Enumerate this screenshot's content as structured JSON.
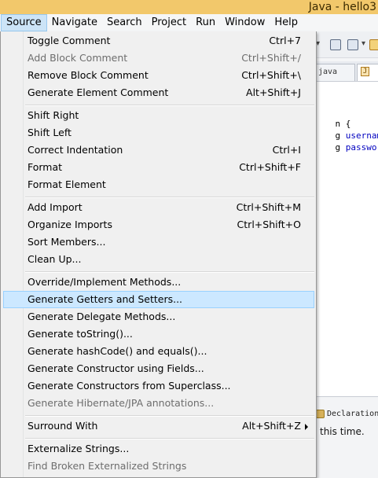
{
  "window": {
    "title": "Java - hello3"
  },
  "menubar": {
    "items": [
      {
        "label": "Source"
      },
      {
        "label": "Navigate"
      },
      {
        "label": "Search"
      },
      {
        "label": "Project"
      },
      {
        "label": "Run"
      },
      {
        "label": "Window"
      },
      {
        "label": "Help"
      }
    ]
  },
  "tabs": {
    "inactive_label": "java",
    "active_label": "*"
  },
  "editor": {
    "lines": [
      {
        "pre": "n {",
        "var": "",
        "post": ""
      },
      {
        "pre": "g ",
        "var": "username",
        "post": ";"
      },
      {
        "pre": "g ",
        "var": "password",
        "post": ";"
      }
    ]
  },
  "lower_panel": {
    "tab_label": "Declaration",
    "message": "this time."
  },
  "menu": {
    "items": [
      {
        "label": "Toggle Comment",
        "shortcut": "Ctrl+7",
        "disabled": false
      },
      {
        "label": "Add Block Comment",
        "shortcut": "Ctrl+Shift+/",
        "disabled": true
      },
      {
        "label": "Remove Block Comment",
        "shortcut": "Ctrl+Shift+\\",
        "disabled": false
      },
      {
        "label": "Generate Element Comment",
        "shortcut": "Alt+Shift+J",
        "disabled": false
      },
      {
        "label": "Shift Right",
        "shortcut": "",
        "disabled": false
      },
      {
        "label": "Shift Left",
        "shortcut": "",
        "disabled": false
      },
      {
        "label": "Correct Indentation",
        "shortcut": "Ctrl+I",
        "disabled": false
      },
      {
        "label": "Format",
        "shortcut": "Ctrl+Shift+F",
        "disabled": false
      },
      {
        "label": "Format Element",
        "shortcut": "",
        "disabled": false
      },
      {
        "label": "Add Import",
        "shortcut": "Ctrl+Shift+M",
        "disabled": false
      },
      {
        "label": "Organize Imports",
        "shortcut": "Ctrl+Shift+O",
        "disabled": false
      },
      {
        "label": "Sort Members...",
        "shortcut": "",
        "disabled": false
      },
      {
        "label": "Clean Up...",
        "shortcut": "",
        "disabled": false
      },
      {
        "label": "Override/Implement Methods...",
        "shortcut": "",
        "disabled": false
      },
      {
        "label": "Generate Getters and Setters...",
        "shortcut": "",
        "disabled": false,
        "highlighted": true
      },
      {
        "label": "Generate Delegate Methods...",
        "shortcut": "",
        "disabled": false
      },
      {
        "label": "Generate toString()...",
        "shortcut": "",
        "disabled": false
      },
      {
        "label": "Generate hashCode() and equals()...",
        "shortcut": "",
        "disabled": false
      },
      {
        "label": "Generate Constructor using Fields...",
        "shortcut": "",
        "disabled": false
      },
      {
        "label": "Generate Constructors from Superclass...",
        "shortcut": "",
        "disabled": false
      },
      {
        "label": "Generate Hibernate/JPA annotations...",
        "shortcut": "",
        "disabled": true
      },
      {
        "label": "Surround With",
        "shortcut": "Alt+Shift+Z",
        "disabled": false,
        "submenu": true
      },
      {
        "label": "Externalize Strings...",
        "shortcut": "",
        "disabled": false
      },
      {
        "label": "Find Broken Externalized Strings",
        "shortcut": "",
        "disabled": true
      }
    ]
  },
  "colors": {
    "title_bar": "#f2c86b",
    "highlight": "#cce8ff",
    "active_menu": "#cce4f7",
    "disabled_text": "#6d6d6d"
  }
}
